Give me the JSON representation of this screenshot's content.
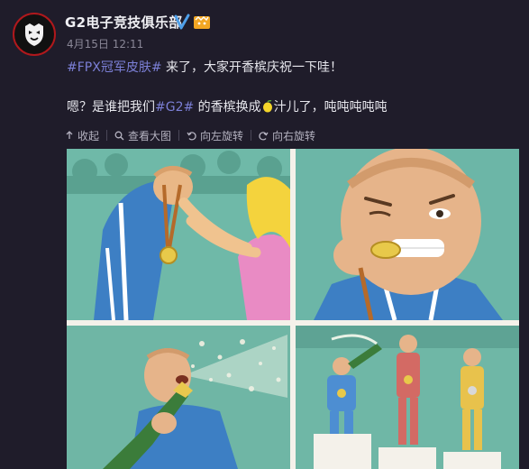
{
  "author": {
    "name": "G2电子竞技俱乐部",
    "time": "4月15日 12:11"
  },
  "post": {
    "topic1": "#FPX冠军皮肤#",
    "text1": " 来了，大家开香槟庆祝一下哇！",
    "text2_a": "嗯？是谁把我们",
    "topic2": "#G2#",
    "text2_b": " 的香槟换成",
    "text2_c": "汁儿了，吨吨吨吨吨"
  },
  "toolbar": {
    "collect": "收起",
    "view_large": "查看大图",
    "rotate_left": "向左旋转",
    "rotate_right": "向右旋转"
  },
  "colors": {
    "background": "#1f1c2a",
    "topic": "#7b7fd6",
    "panel_teal": "#6fb9a8"
  }
}
